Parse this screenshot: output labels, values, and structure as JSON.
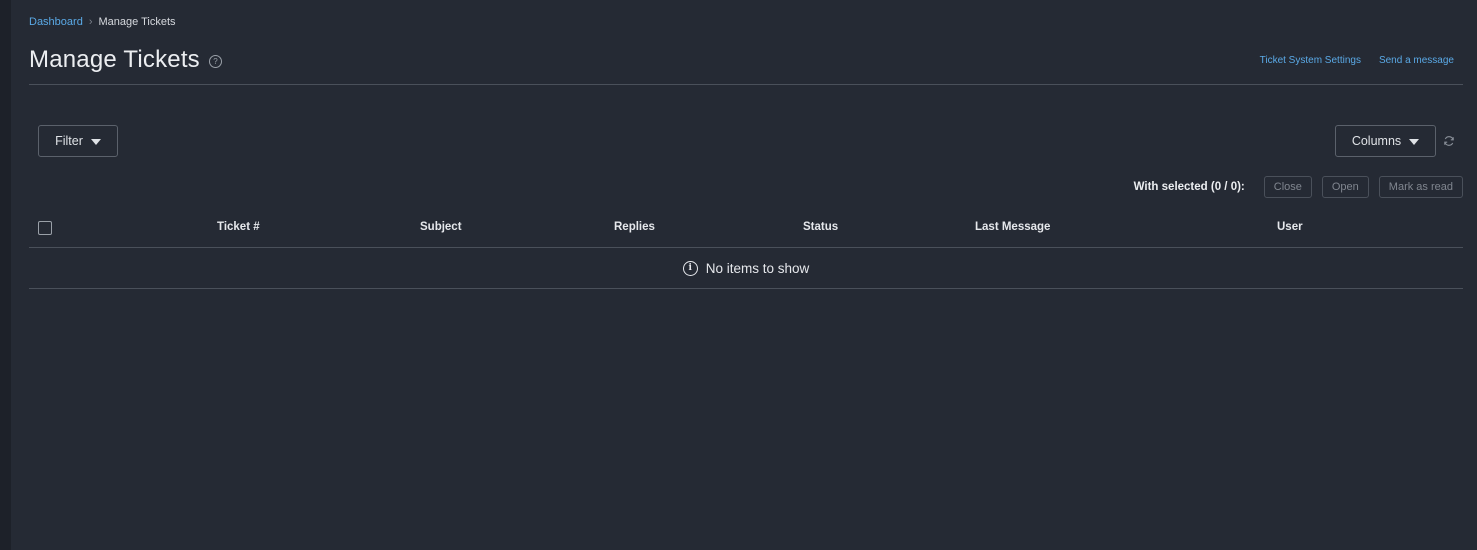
{
  "breadcrumb": {
    "home": "Dashboard",
    "separator": "›",
    "current": "Manage Tickets"
  },
  "header": {
    "title": "Manage Tickets",
    "help_icon": "question-circle-icon",
    "links": {
      "settings": "Ticket System Settings",
      "send_message": "Send a message"
    }
  },
  "toolbar": {
    "filter_label": "Filter",
    "columns_label": "Columns",
    "refresh_icon": "refresh-icon"
  },
  "bulk": {
    "label": "With selected (0 / 0):",
    "close": "Close",
    "open": "Open",
    "mark_read": "Mark as read"
  },
  "table": {
    "columns": [
      "Ticket #",
      "Subject",
      "Replies",
      "Status",
      "Last Message",
      "User"
    ],
    "empty_message": "No items to show"
  },
  "colors": {
    "background": "#252a34",
    "link": "#5aa9e6",
    "border": "#4a505a"
  }
}
